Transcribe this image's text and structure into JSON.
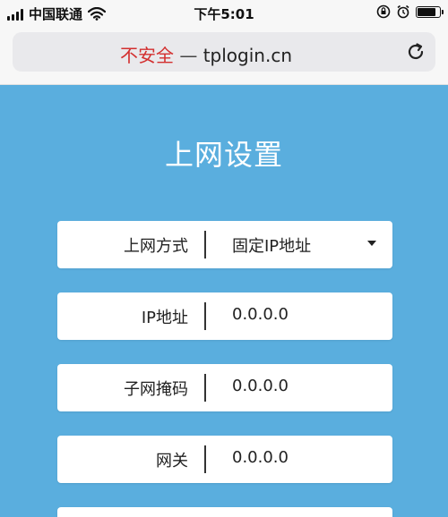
{
  "status_bar": {
    "carrier": "中国联通",
    "time": "下午5:01",
    "icons": [
      "signal-icon",
      "wifi-icon",
      "lock-rotation-icon",
      "alarm-icon",
      "battery-icon"
    ]
  },
  "browser": {
    "insecure_label": "不安全",
    "separator": " — ",
    "domain": "tplogin.cn",
    "reload_icon": "reload-icon"
  },
  "page": {
    "title": "上网设置",
    "fields": [
      {
        "label": "上网方式",
        "value": "固定IP地址",
        "type": "select"
      },
      {
        "label": "IP地址",
        "value": "0.0.0.0",
        "type": "input"
      },
      {
        "label": "子网掩码",
        "value": "0.0.0.0",
        "type": "input"
      },
      {
        "label": "网关",
        "value": "0.0.0.0",
        "type": "input"
      }
    ]
  },
  "colors": {
    "background": "#5aaede",
    "insecure": "#d32f2f"
  }
}
